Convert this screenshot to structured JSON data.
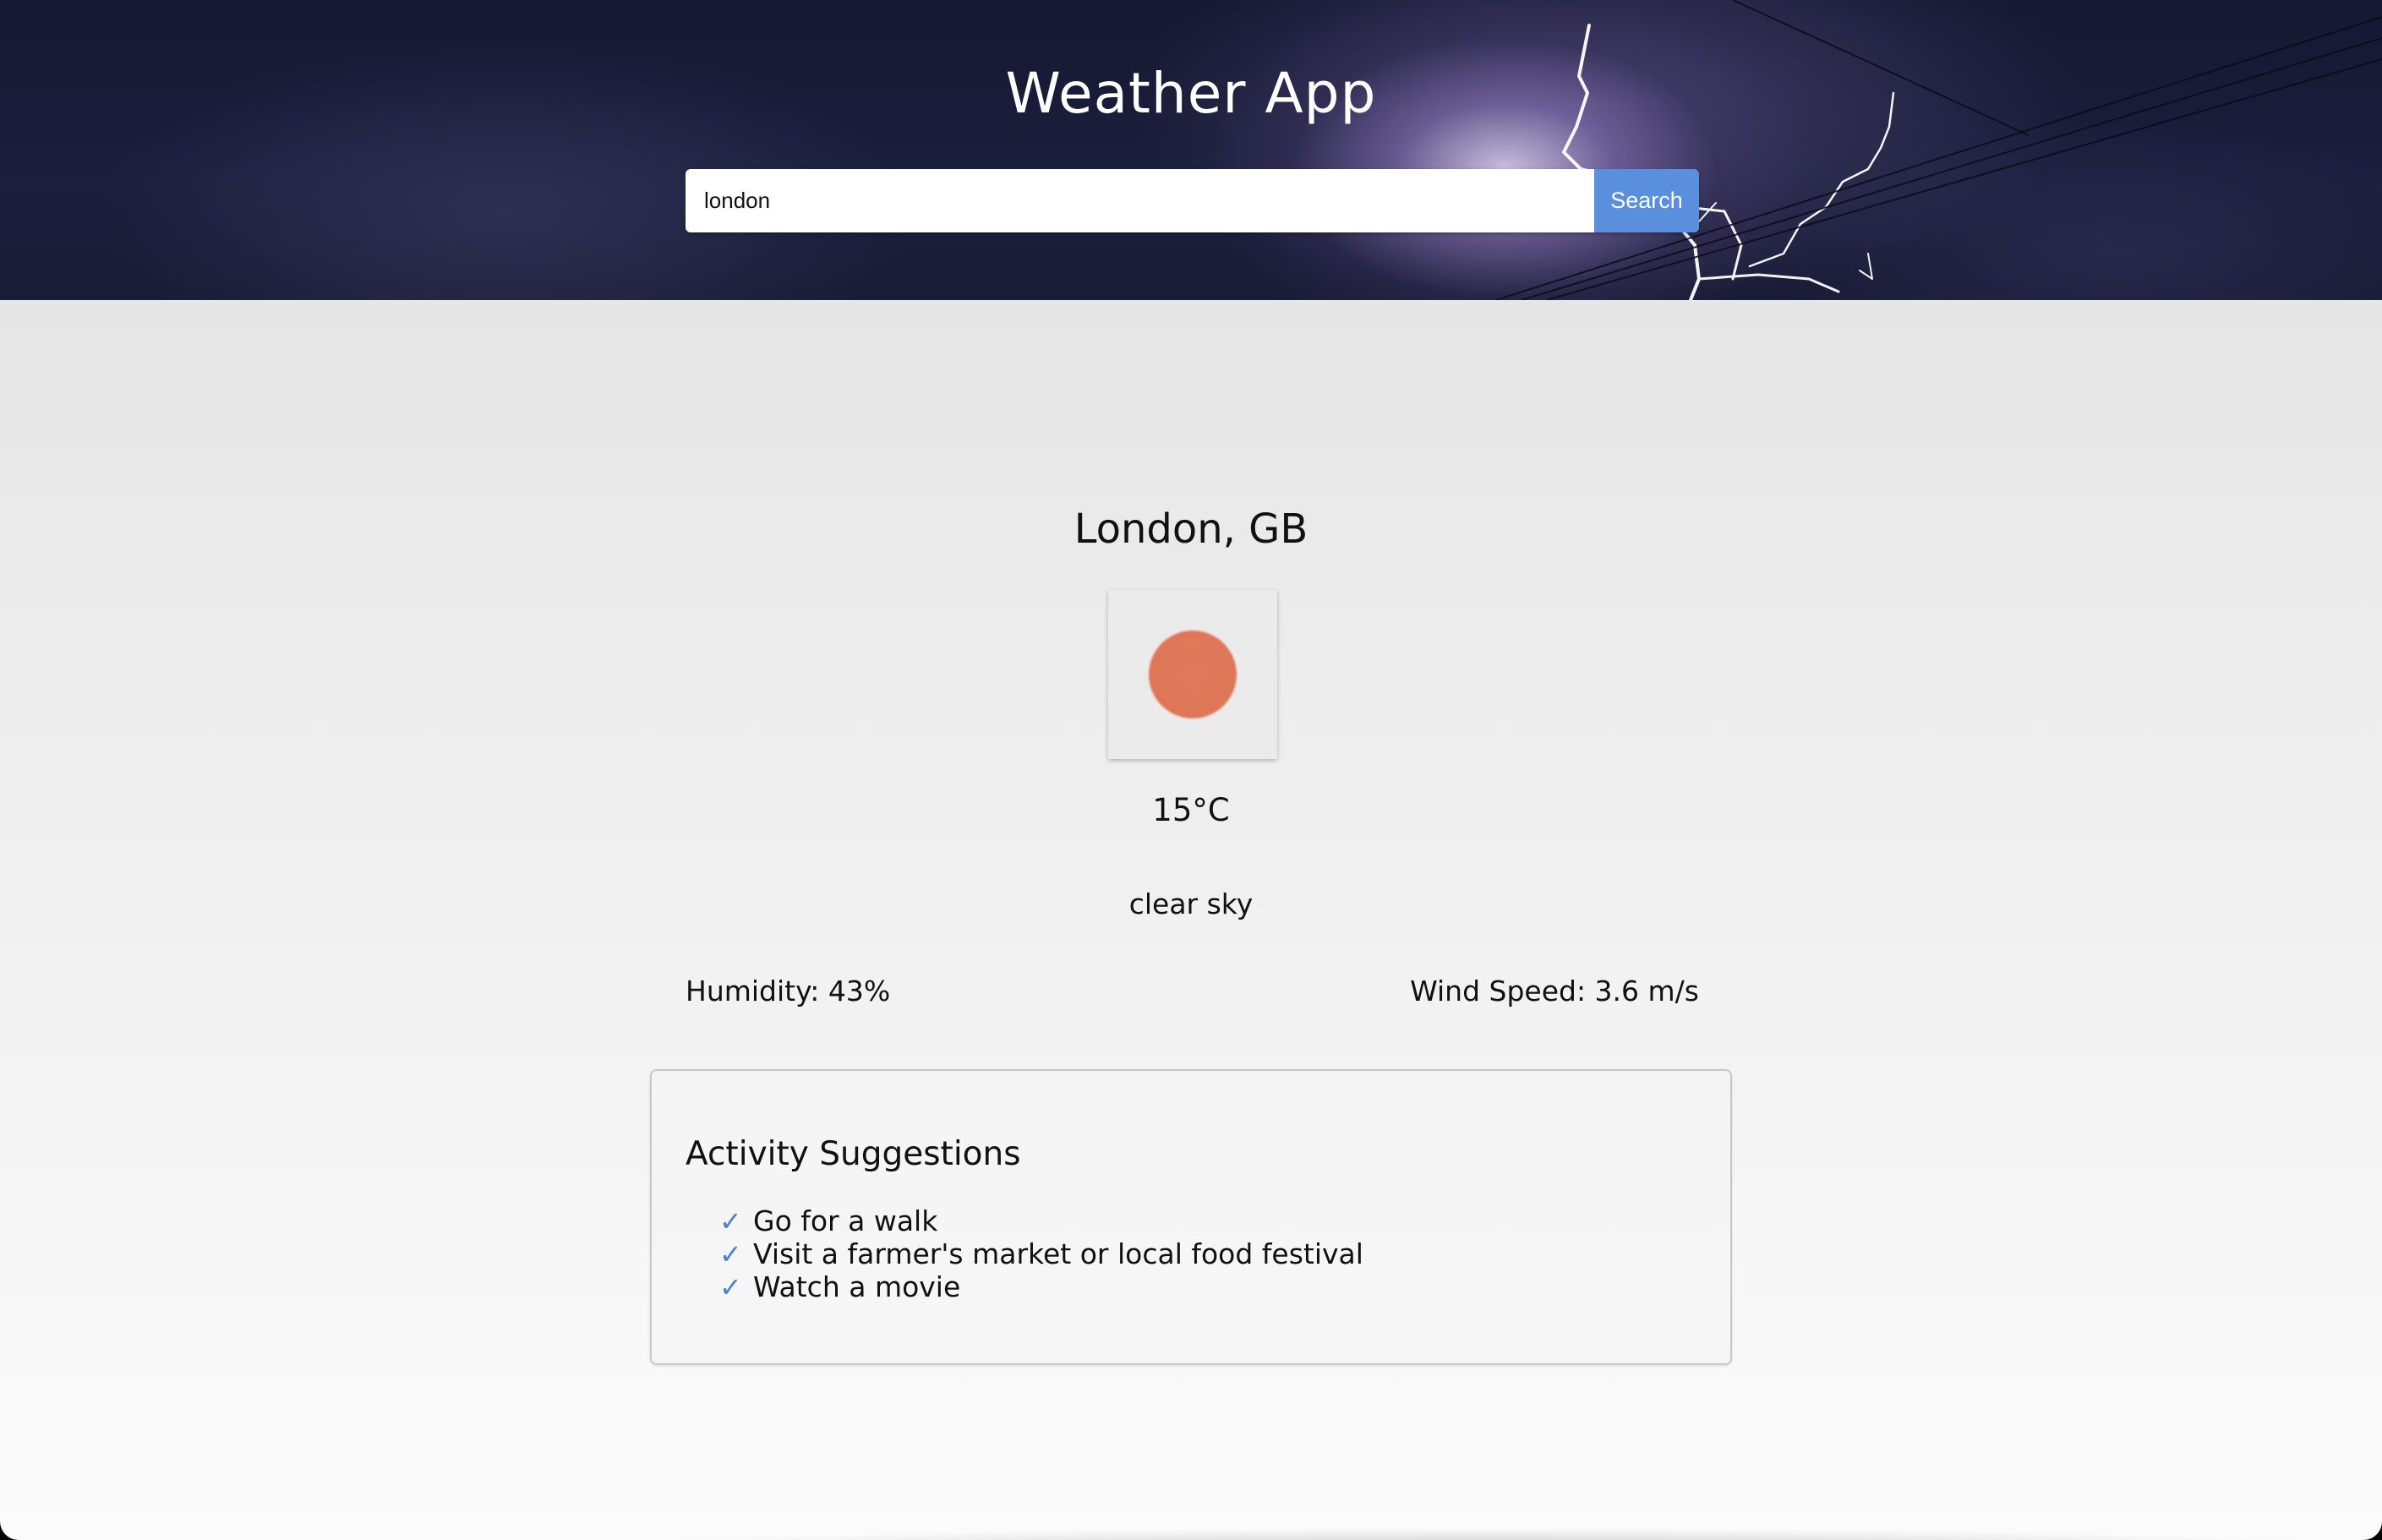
{
  "header": {
    "title": "Weather App",
    "search": {
      "value": "london",
      "button_label": "Search"
    }
  },
  "weather": {
    "location": "London, GB",
    "icon": "sun-icon",
    "icon_color": "#df7658",
    "temperature": "15°C",
    "description": "clear sky",
    "humidity": "Humidity: 43%",
    "wind_speed": "Wind Speed: 3.6 m/s"
  },
  "activities": {
    "title": "Activity Suggestions",
    "check_glyph": "✓",
    "items": [
      "Go for a walk",
      "Visit a farmer's market or local food festival",
      "Watch a movie"
    ]
  },
  "colors": {
    "accent": "#5a8fde",
    "check": "#4a7fd1"
  }
}
